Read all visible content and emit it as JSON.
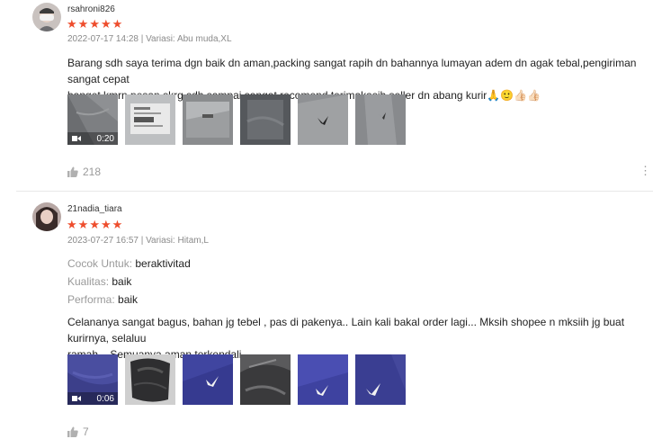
{
  "reviews": [
    {
      "username": "rsahroni826",
      "rating": 5,
      "meta": "2022-07-17 14:28 | Variasi: Abu muda,XL",
      "text_line1": "Barang sdh saya terima dgn baik dn aman,packing sangat rapih dn bahannya lumayan adem dn agak tebal,pengiriman sangat cepat",
      "text_line2": "banget kmrn pesan skrg sdh sampai,sangat recomend terimakasih seller dn abang kurir🙏🙂👍🏻👍🏻",
      "video_duration": "0:20",
      "likes": "218",
      "more_icon": "more-dots-icon"
    },
    {
      "username": "21nadia_tiara",
      "rating": 5,
      "meta": "2023-07-27 16:57 | Variasi: Hitam,L",
      "attributes": [
        {
          "label": "Cocok Untuk:",
          "value": "beraktivitad"
        },
        {
          "label": "Kualitas:",
          "value": "baik"
        },
        {
          "label": "Performa:",
          "value": "baik"
        }
      ],
      "text_line1": "Celananya sangat bagus, bahan jg tebel , pas di pakenya.. Lain kali bakal order lagi... Mksih shopee n mksiih jg buat kurirnya, selaluu",
      "text_line2": "ramah... Semuanya aman terkendali",
      "video_duration": "0:06",
      "likes": "7"
    }
  ],
  "colors": {
    "star": "#ee4d2d",
    "muted": "#9a9a9a",
    "divider": "#e8e8e8"
  }
}
